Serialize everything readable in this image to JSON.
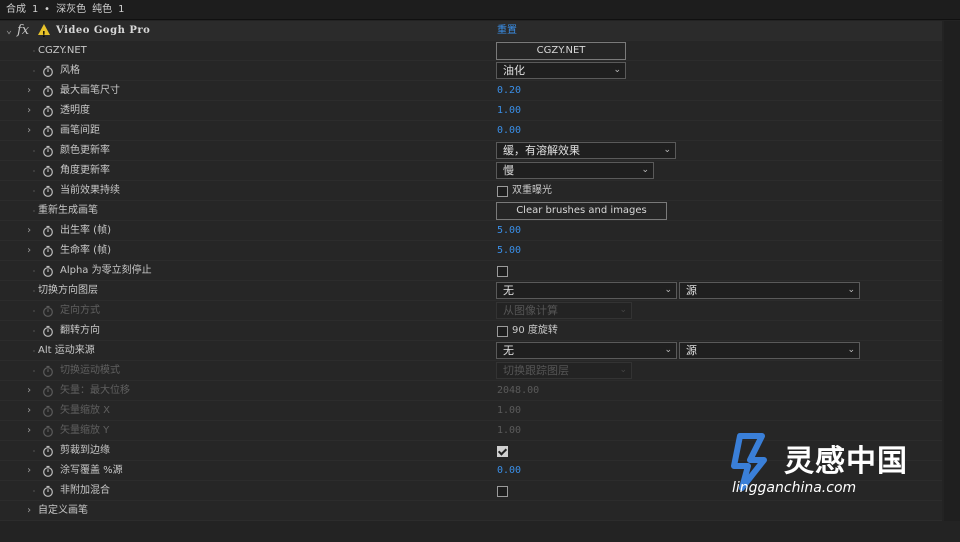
{
  "titlebar": {
    "text": "合成 1 • 深灰色 纯色 1"
  },
  "effect": {
    "name": "Video Gogh Pro",
    "reset_label": "重置",
    "fx_label": "fx"
  },
  "rows": {
    "cgzy": {
      "label": "CGZY.NET",
      "button": "CGZY.NET"
    },
    "style": {
      "label": "风格",
      "value": "油化"
    },
    "max_brush": {
      "label": "最大画笔尺寸",
      "value": "0.20"
    },
    "opacity": {
      "label": "透明度",
      "value": "1.00"
    },
    "brush_spacing": {
      "label": "画笔间距",
      "value": "0.00"
    },
    "color_rate": {
      "label": "颜色更新率",
      "value": "缓，有溶解效果"
    },
    "angle_rate": {
      "label": "角度更新率",
      "value": "慢"
    },
    "persist": {
      "label": "当前效果持续",
      "checkbox_label": "双重曝光",
      "checked": false
    },
    "regen": {
      "label": "重新生成画笔",
      "button": "Clear brushes and images cached"
    },
    "birth": {
      "label": "出生率 (帧)",
      "value": "5.00"
    },
    "life": {
      "label": "生命率 (帧)",
      "value": "5.00"
    },
    "alpha_stop": {
      "label": "Alpha 为零立刻停止",
      "checked": false
    },
    "switch_dir": {
      "label": "切换方向图层",
      "value1": "无",
      "value2": "源"
    },
    "orient": {
      "label": "定向方式",
      "value": "从图像计算"
    },
    "flip": {
      "label": "翻转方向",
      "checkbox_label": "90 度旋转",
      "checked": false
    },
    "alt_motion": {
      "label": "Alt 运动来源",
      "value1": "无",
      "value2": "源"
    },
    "switch_motion": {
      "label": "切换运动模式",
      "value": "切换跟踪图层"
    },
    "vec_max": {
      "label": "矢量：最大位移",
      "value": "2048.00"
    },
    "vec_x": {
      "label": "矢量缩放 X",
      "value": "1.00"
    },
    "vec_y": {
      "label": "矢量缩放 Y",
      "value": "1.00"
    },
    "clip_edge": {
      "label": "剪裁到边缘",
      "checked": true
    },
    "coat": {
      "label": "涂写覆盖 %源",
      "value": "0.00"
    },
    "non_add": {
      "label": "非附加混合",
      "checked": false
    },
    "custom_brush": {
      "label": "自定义画笔"
    }
  },
  "watermark": {
    "brand": "灵感中国",
    "url": "lingganchina.com"
  },
  "colors": {
    "accent": "#3a8ee6",
    "background": "#232323",
    "logo": "#3a7fd8"
  }
}
